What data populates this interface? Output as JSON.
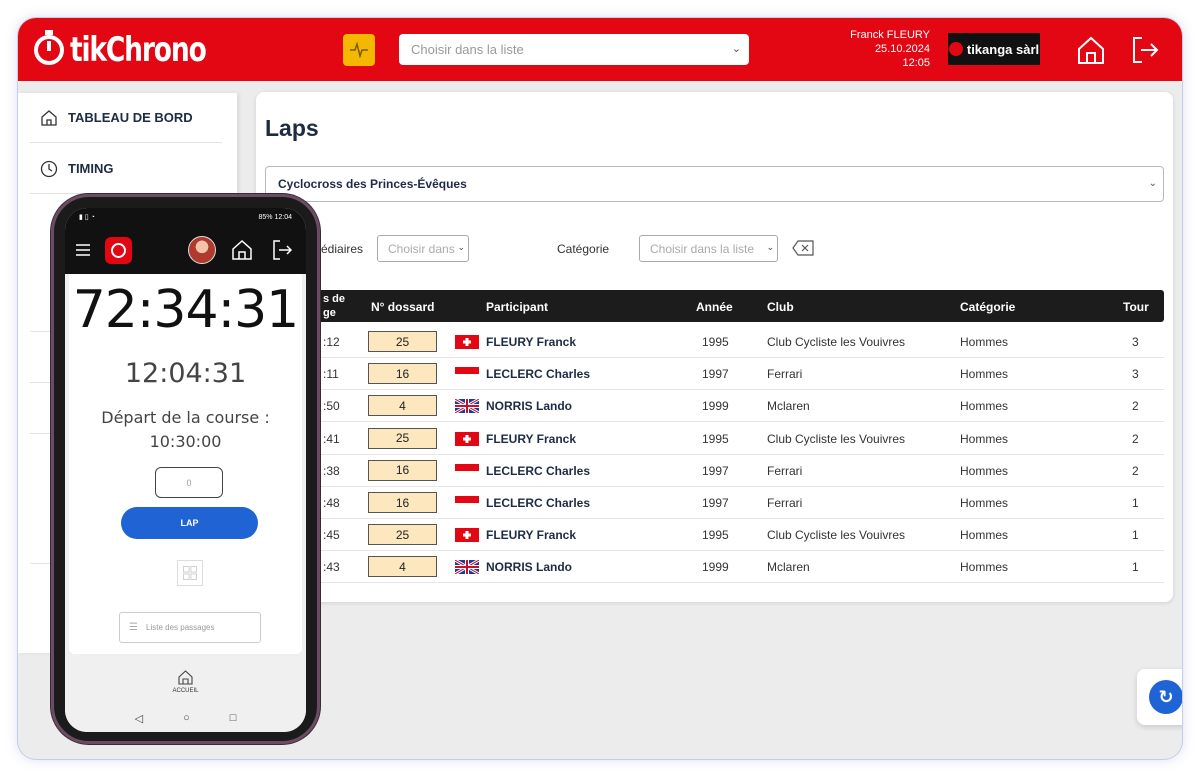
{
  "header": {
    "logo_text": "tikChrono",
    "select_placeholder": "Choisir dans la liste",
    "user_name": "Franck FLEURY",
    "date": "25.10.2024",
    "time": "12:05",
    "sponsor_name": "tikanga sàrl",
    "brand_color": "#e30613"
  },
  "sidebar": {
    "items": [
      {
        "label": "TABLEAU DE BORD",
        "icon": "home-icon"
      },
      {
        "label": "TIMING",
        "icon": "clock-icon"
      }
    ]
  },
  "main": {
    "title": "Laps",
    "event": "Cyclocross des Princes-Évêques",
    "filters": {
      "intermediates_label": "édiaires",
      "intermediates_placeholder": "Choisir dans",
      "category_label": "Catégorie",
      "category_placeholder": "Choisir dans la liste"
    },
    "table": {
      "columns": [
        "s de\nge",
        "N° dossard",
        "Participant",
        "Année",
        "Club",
        "Catégorie",
        "Tour"
      ],
      "rows": [
        {
          "time": ":12",
          "bib": "25",
          "flag": "ch",
          "name": "FLEURY Franck",
          "year": "1995",
          "club": "Club Cycliste les Vouivres",
          "category": "Hommes",
          "lap": "3"
        },
        {
          "time": ":11",
          "bib": "16",
          "flag": "mc",
          "name": "LECLERC Charles",
          "year": "1997",
          "club": "Ferrari",
          "category": "Hommes",
          "lap": "3"
        },
        {
          "time": ":50",
          "bib": "4",
          "flag": "gb",
          "name": "NORRIS Lando",
          "year": "1999",
          "club": "Mclaren",
          "category": "Hommes",
          "lap": "2"
        },
        {
          "time": ":41",
          "bib": "25",
          "flag": "ch",
          "name": "FLEURY Franck",
          "year": "1995",
          "club": "Club Cycliste les Vouivres",
          "category": "Hommes",
          "lap": "2"
        },
        {
          "time": ":38",
          "bib": "16",
          "flag": "mc",
          "name": "LECLERC Charles",
          "year": "1997",
          "club": "Ferrari",
          "category": "Hommes",
          "lap": "2"
        },
        {
          "time": ":48",
          "bib": "16",
          "flag": "mc",
          "name": "LECLERC Charles",
          "year": "1997",
          "club": "Ferrari",
          "category": "Hommes",
          "lap": "1"
        },
        {
          "time": ":45",
          "bib": "25",
          "flag": "ch",
          "name": "FLEURY Franck",
          "year": "1995",
          "club": "Club Cycliste les Vouivres",
          "category": "Hommes",
          "lap": "1"
        },
        {
          "time": ":43",
          "bib": "4",
          "flag": "gb",
          "name": "NORRIS Lando",
          "year": "1999",
          "club": "Mclaren",
          "category": "Hommes",
          "lap": "1"
        }
      ]
    }
  },
  "phone": {
    "status_time": "12:04",
    "battery": "85%",
    "timer": "72:34:31",
    "clock": "12:04:31",
    "depart_label": "Départ de la course :",
    "depart_time": "10:30:00",
    "input_value": "0",
    "lap_label": "LAP",
    "list_label": "Liste des passages",
    "footer_label": "ACCUEIL",
    "primary_color": "#1f63d4"
  }
}
